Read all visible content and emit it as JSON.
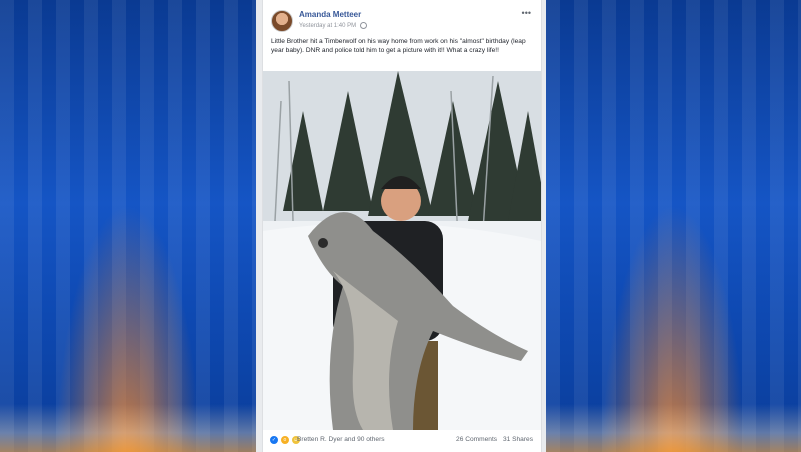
{
  "post": {
    "author": "Amanda Metteer",
    "timestamp": "Yesterday at 1:40 PM",
    "message": "Little Brother hit a Timberwolf on his way home from work on his \"almost\" birthday (leap year baby). DNR and police told him to get a picture with it!! What a crazy life!!",
    "reactions_text": "Bretten R. Dyer and 90 others",
    "comments": "26 Comments",
    "shares": "31 Shares"
  },
  "icons": {
    "more": "more-icon",
    "privacy": "globe-icon",
    "reactions": [
      "like-icon",
      "wow-icon",
      "haha-icon"
    ]
  },
  "colors": {
    "author_link": "#385898",
    "background_blue": "#0b3f9c",
    "like_blue": "#1877f2"
  }
}
